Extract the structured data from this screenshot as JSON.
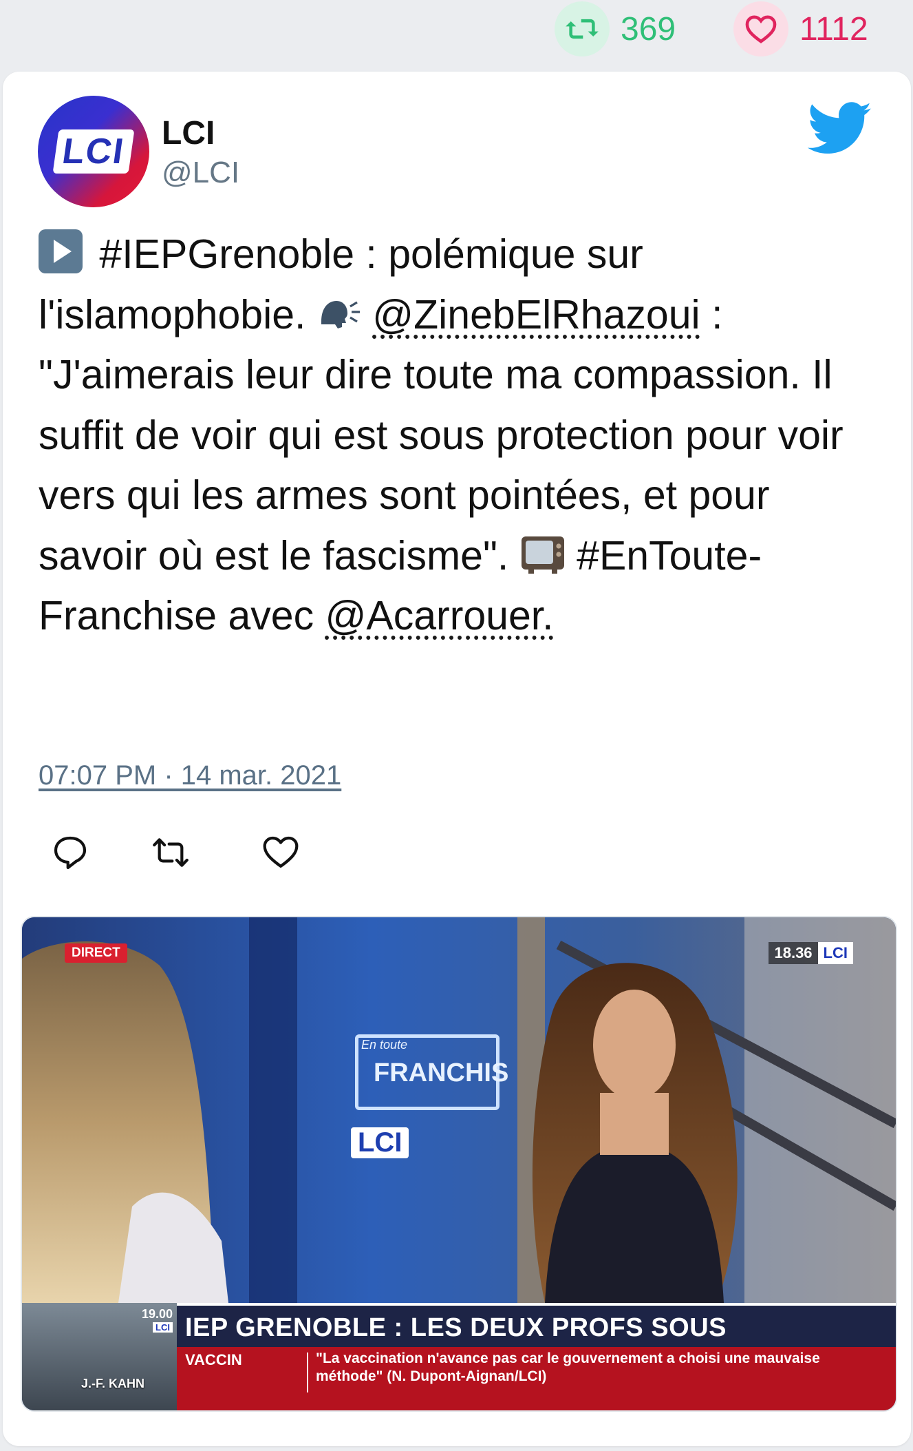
{
  "stats": {
    "retweets": "369",
    "likes": "1112"
  },
  "author": {
    "name": "LCI",
    "handle": "@LCI",
    "avatar_text": "LCI"
  },
  "tweet": {
    "part1": "#IEPGrenoble : polémique sur l'islamophobie.",
    "mention1": "@ZinebElRhazoui",
    "part2": " : \"J'aimerais leur dire toute ma compassion. Il suffit de voir qui est sous protection pour voir vers qui les armes sont pointées, et pour savoir où est le fascisme\".",
    "part3": "#EnToute­Franchise avec",
    "mention2": "@Acarrouer."
  },
  "timestamp": "07:07 PM · 14 mar. 2021",
  "media": {
    "bug_direct": "DIRECT",
    "bug_time": "18.36",
    "bug_channel": "LCI",
    "studio_logo": "LCI",
    "studio_sign_small": "En toute",
    "studio_sign_big": "FRANCHIS",
    "ticker_time": "19.00",
    "ticker_channel": "LCI",
    "ticker_guest": "J.-F. KAHN",
    "headline": "IEP GRENOBLE : LES DEUX PROFS SOUS PROTECTION",
    "category": "VACCIN",
    "quote": "\"La vaccination n'avance pas car le gouvernement a choisi une mauvaise méthode\" (N. Dupont-Aignan/LCI)"
  },
  "colors": {
    "retweet_green": "#2fbf77",
    "like_pink": "#e0245e",
    "twitter_blue": "#1da1f2",
    "background": "#ebedf0"
  }
}
